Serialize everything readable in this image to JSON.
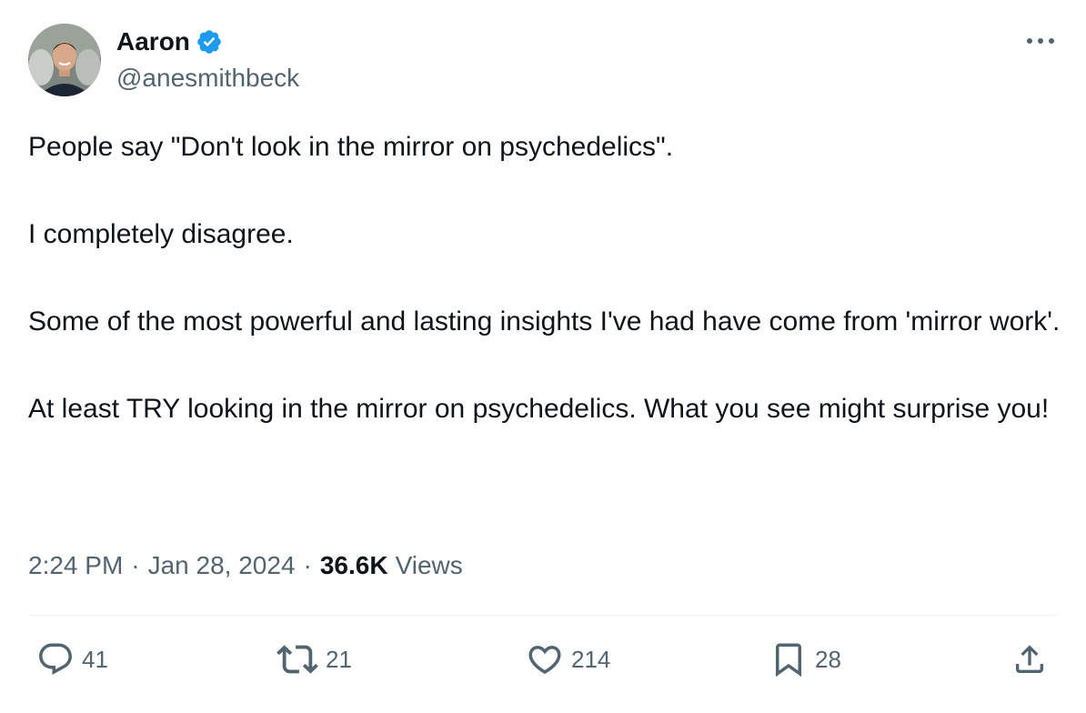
{
  "author": {
    "display_name": "Aaron",
    "handle": "@anesmithbeck",
    "verified": true
  },
  "tweet": {
    "paragraphs": [
      "People say \"Don't look in the mirror on psychedelics\".",
      "I completely disagree.",
      "Some of the most powerful and lasting insights I've had have come from 'mirror work'.",
      "At least TRY looking in the mirror on psychedelics. What you see might surprise you!"
    ],
    "time": "2:24 PM",
    "separator": "·",
    "date": "Jan 28, 2024",
    "views_count": "36.6K",
    "views_label": "Views"
  },
  "actions": {
    "replies": "41",
    "retweets": "21",
    "likes": "214",
    "bookmarks": "28"
  },
  "icons": {
    "verified": "verified-badge-icon",
    "more": "more-horizontal-icon",
    "reply": "reply-icon",
    "retweet": "retweet-icon",
    "like": "heart-icon",
    "bookmark": "bookmark-icon",
    "share": "share-icon"
  },
  "colors": {
    "text": "#0f1419",
    "secondary": "#536471",
    "verified": "#1d9bf0",
    "divider": "#eff3f4"
  }
}
